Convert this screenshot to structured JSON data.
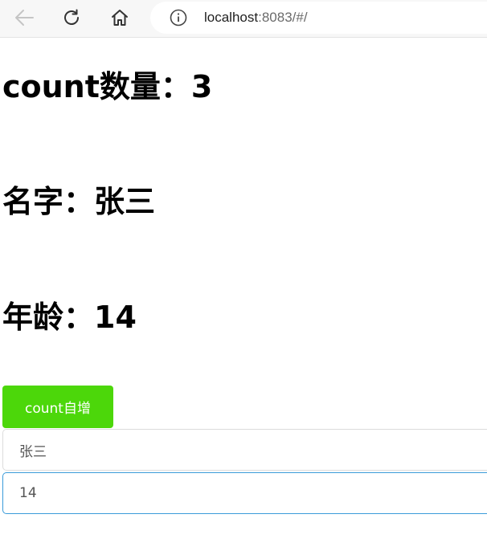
{
  "browser": {
    "url_host": "localhost",
    "url_rest": ":8083/#/",
    "icons": [
      "back-arrow-icon",
      "reload-icon",
      "home-icon",
      "info-icon"
    ]
  },
  "main": {
    "count_heading": "count数量：3",
    "name_heading": "名字：张三",
    "age_heading": "年龄：14",
    "increment_button": "count自增",
    "name_input_value": "张三",
    "age_input_value": "14"
  },
  "colors": {
    "button_bg": "#4cd70a",
    "focused_border": "#3a9bd9"
  }
}
